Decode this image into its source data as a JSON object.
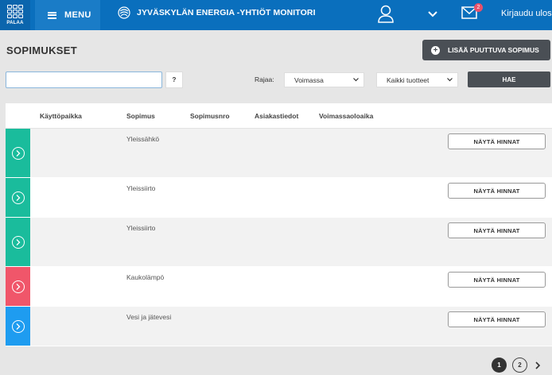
{
  "header": {
    "back_label": "PALAA",
    "menu_label": "MENU",
    "brand_title": "JYVÄSKYLÄN ENERGIA -YHTIÖT MONITORI",
    "notification_count": "2",
    "logout_label": "Kirjaudu ulos",
    "icons": [
      "grid-icon",
      "hamburger-icon",
      "brand-logo",
      "user-icon",
      "chevron-down-icon",
      "mail-icon"
    ],
    "bar_color": "#0a6fbd"
  },
  "page": {
    "title": "SOPIMUKSET",
    "add_button_label": "LISÄÄ PUUTTUVA SOPIMUS"
  },
  "search": {
    "value": "",
    "help_label": "?",
    "filter_label": "Rajaa:",
    "status_select": "Voimassa",
    "product_select": "Kaikki tuotteet",
    "submit_label": "HAE"
  },
  "table": {
    "columns": [
      "Käyttöpaikka",
      "Sopimus",
      "Sopimusnro",
      "Asiakastiedot",
      "Voimassaoloaika"
    ],
    "rows": [
      {
        "sopimus": "Yleissähkö",
        "button": "NÄYTÄ HINNAT",
        "color": "#1abc9c"
      },
      {
        "sopimus": "Yleissiirto",
        "button": "NÄYTÄ HINNAT",
        "color": "#1abc9c"
      },
      {
        "sopimus": "Yleissiirto",
        "button": "NÄYTÄ HINNAT",
        "color": "#1abc9c"
      },
      {
        "sopimus": "Kaukolämpö",
        "button": "NÄYTÄ HINNAT",
        "color": "#f0566a"
      },
      {
        "sopimus": "Vesi ja jätevesi",
        "button": "NÄYTÄ HINNAT",
        "color": "#1e9cf0"
      }
    ]
  },
  "pagination": {
    "pages": [
      "1",
      "2"
    ],
    "current": "1",
    "next_icon": "chevron-right-icon"
  }
}
